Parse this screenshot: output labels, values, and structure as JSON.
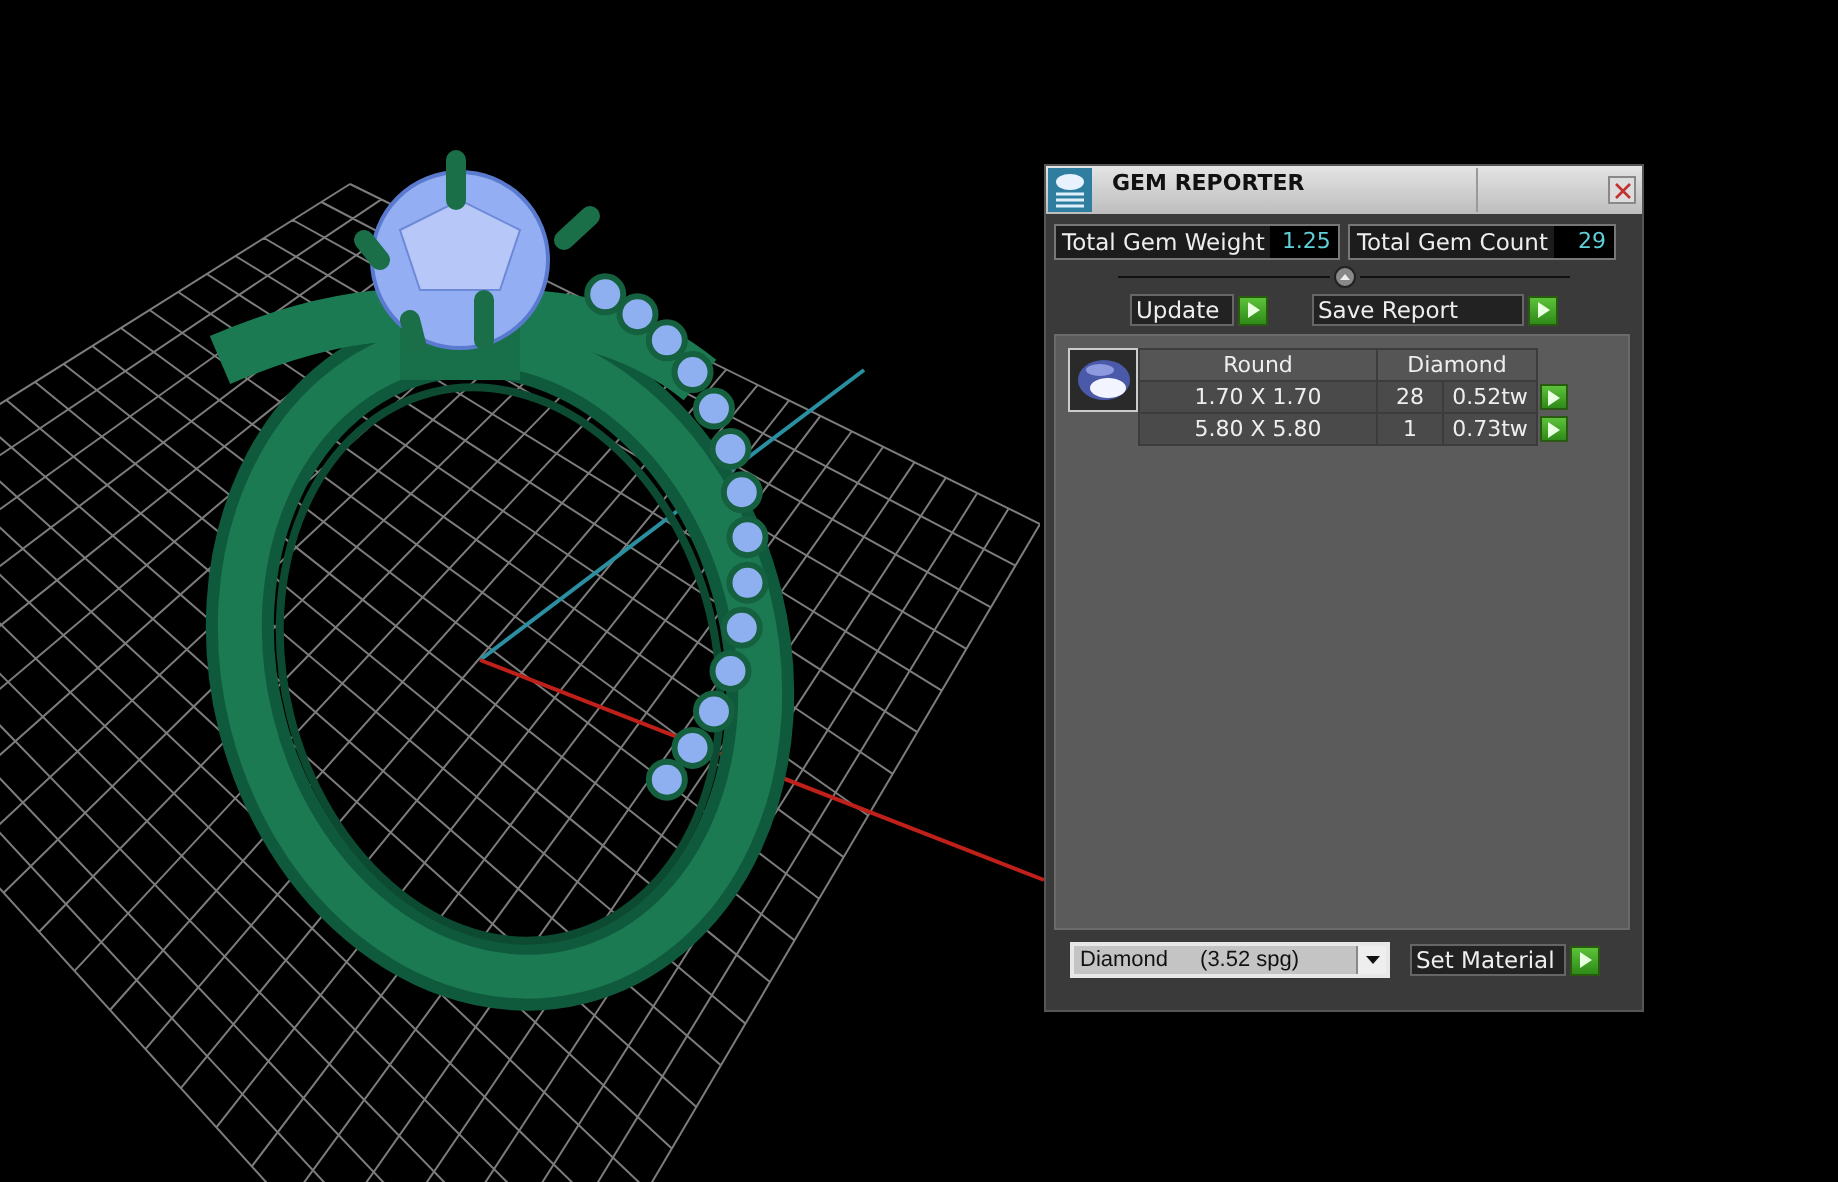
{
  "window": {
    "title": "GEM REPORTER"
  },
  "totals": [
    {
      "label": "Total Gem Weight",
      "value": "1.25"
    },
    {
      "label": "Total Gem Count",
      "value": "29"
    }
  ],
  "buttons": [
    "Update",
    "Save Report"
  ],
  "gem_table": {
    "columns": [
      "Round",
      "Diamond"
    ],
    "rows": [
      {
        "size": "1.70 X 1.70",
        "count": "28",
        "weight": "0.52tw"
      },
      {
        "size": "5.80 X 5.80",
        "count": "1",
        "weight": "0.73tw"
      }
    ]
  },
  "material": {
    "value": "Diamond",
    "density": "(3.52 spg)"
  },
  "set_button": "Set Material"
}
